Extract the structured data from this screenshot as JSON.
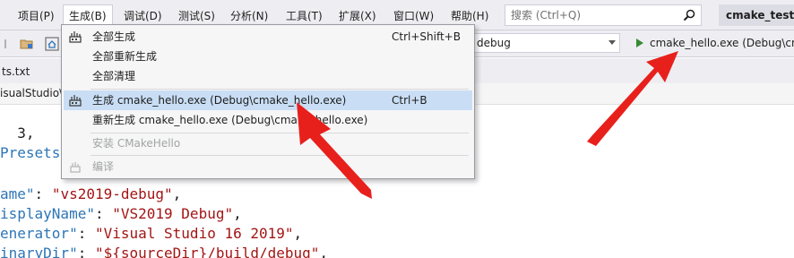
{
  "menubar": {
    "items": [
      "项目(P)",
      "生成(B)",
      "调试(D)",
      "测试(S)",
      "分析(N)",
      "工具(T)",
      "扩展(X)",
      "窗口(W)",
      "帮助(H)"
    ],
    "search_placeholder": "搜索 (Ctrl+Q)",
    "project_title": "cmake_test"
  },
  "toolbar": {
    "config_value": "debug",
    "run_label": "cmake_hello.exe (Debug\\cm"
  },
  "tab": {
    "label": "ts.txt"
  },
  "navbar": {
    "path": "isualStudio\\"
  },
  "build_menu": {
    "items": [
      {
        "label": "全部生成",
        "shortcut": "Ctrl+Shift+B",
        "icon": "build-icon"
      },
      {
        "label": "全部重新生成",
        "shortcut": ""
      },
      {
        "label": "全部清理",
        "shortcut": ""
      },
      {
        "label": "生成 cmake_hello.exe (Debug\\cmake_hello.exe)",
        "shortcut": "Ctrl+B",
        "icon": "build-icon",
        "highlighted": true
      },
      {
        "label": "重新生成 cmake_hello.exe (Debug\\cmake_hello.exe)",
        "shortcut": ""
      },
      {
        "label": "安装 CMakeHello",
        "shortcut": "",
        "disabled": true
      },
      {
        "label": "编译",
        "shortcut": "",
        "disabled": true,
        "icon": "compile-icon"
      }
    ]
  },
  "code": {
    "line1": "3,",
    "line2": "Presets",
    "line3": {
      "key": "ame",
      "value": "\"vs2019-debug\""
    },
    "line4": {
      "key": "isplayName",
      "value": "\"VS2019 Debug\""
    },
    "line5": {
      "key": "enerator",
      "value": "\"Visual Studio 16 2019\""
    },
    "line6": {
      "key": "inaryDir",
      "value": "\"${sourceDir}/build/debug\""
    }
  },
  "colors": {
    "menu_bg": "#eeeef2",
    "highlight": "#c9def5",
    "annotation_arrow": "#e8201c",
    "json_key": "#2e75b6",
    "json_string": "#a31515"
  }
}
